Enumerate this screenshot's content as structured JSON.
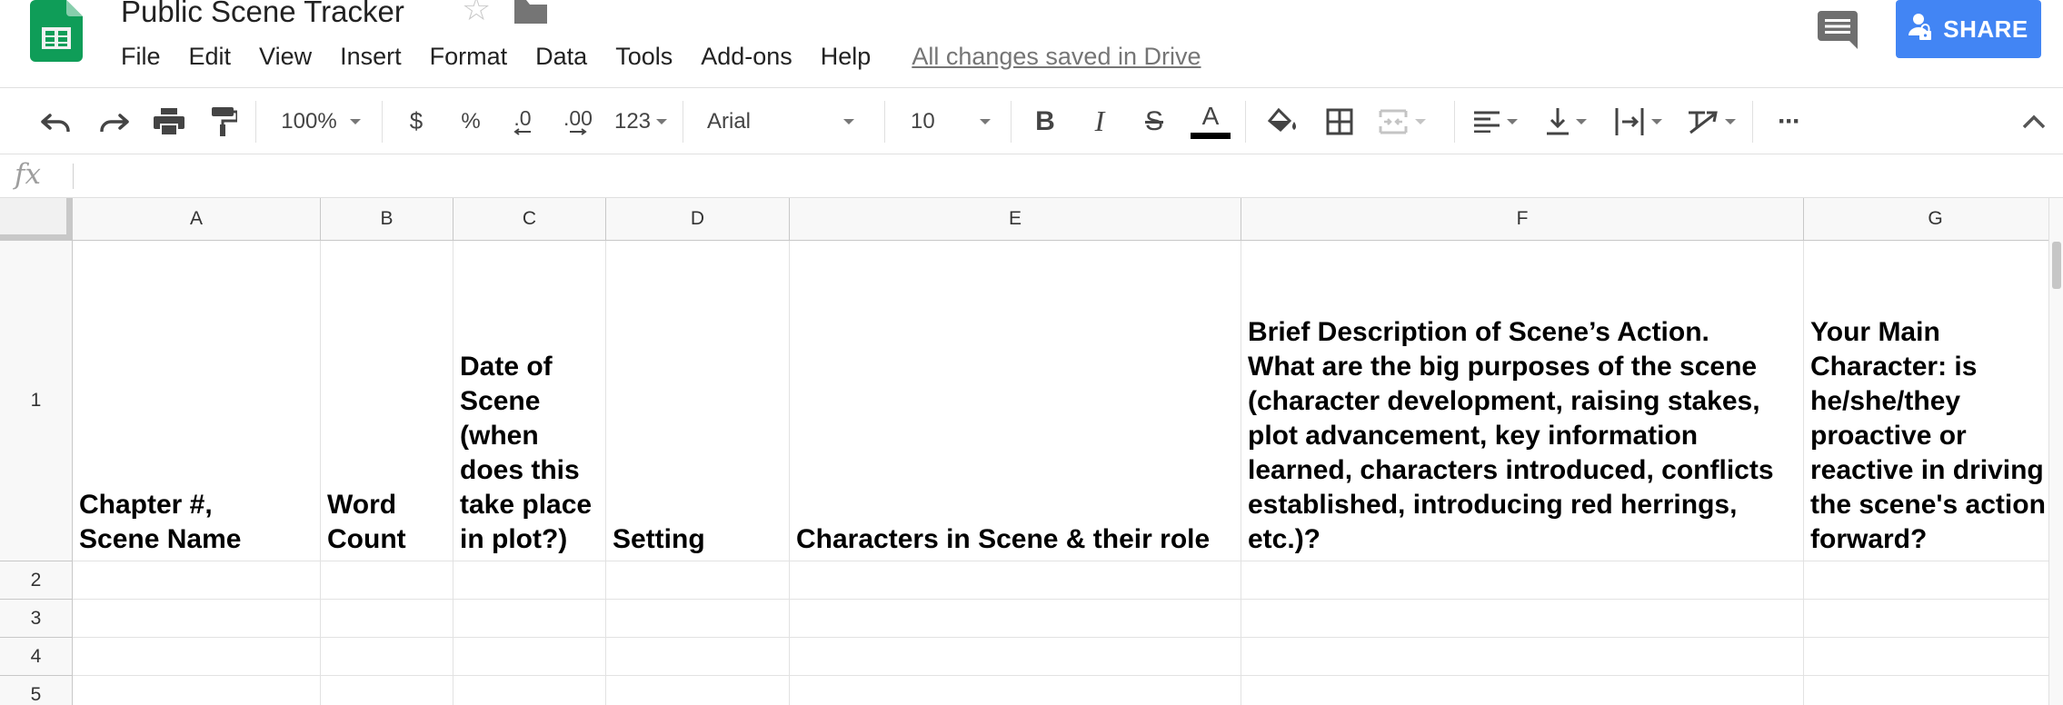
{
  "app": {
    "title": "Public Scene Tracker",
    "logo_icon": "google-sheets-logo",
    "accent_color": "#4285f4",
    "sheets_green": "#0f9d58"
  },
  "menu": {
    "items": [
      "File",
      "Edit",
      "View",
      "Insert",
      "Format",
      "Data",
      "Tools",
      "Add-ons",
      "Help"
    ],
    "save_status": "All changes saved in Drive"
  },
  "share": {
    "label": "SHARE",
    "icon": "person-lock-icon"
  },
  "toolbar": {
    "zoom": "100%",
    "currency": "$",
    "percent": "%",
    "decrease_decimal": ".0",
    "increase_decimal": ".00",
    "more_formats": "123",
    "font": "Arial",
    "font_size": "10",
    "bold": "B",
    "italic": "I",
    "strikethrough": "S",
    "text_color": "A",
    "more": "···",
    "icons": [
      "undo-icon",
      "redo-icon",
      "print-icon",
      "paint-format-icon",
      "fill-color-icon",
      "borders-icon",
      "merge-cells-icon",
      "horizontal-align-icon",
      "vertical-align-icon",
      "text-wrapping-icon",
      "text-rotation-icon",
      "more-icon",
      "collapse-icon"
    ]
  },
  "formula_bar": {
    "icon": "fx",
    "value": ""
  },
  "grid": {
    "columns": [
      "A",
      "B",
      "C",
      "D",
      "E",
      "F",
      "G"
    ],
    "rows": [
      "1",
      "2",
      "3",
      "4",
      "5"
    ],
    "header_row": [
      "Chapter #,\nScene Name",
      "Word\nCount",
      "Date of\nScene\n(when\ndoes this\ntake place\nin plot?)",
      "Setting",
      "Characters in Scene & their role",
      "Brief Description of Scene’s Action.\nWhat are the big purposes of the scene\n(character development, raising stakes,\nplot advancement, key information\nlearned, characters introduced, conflicts\nestablished, introducing red herrings,\netc.)?",
      "Your Main\nCharacter: is\nhe/she/they\nproactive or\nreactive in driving\nthe scene's action\nforward?"
    ]
  }
}
